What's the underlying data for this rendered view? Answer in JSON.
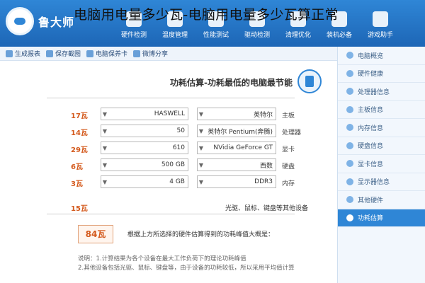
{
  "overlay_title": "电脑用电量多少瓦-电脑用电量多少瓦算正常",
  "app": {
    "brand": "鲁大师"
  },
  "header_tabs": [
    {
      "label": "硬件检测",
      "active": false
    },
    {
      "label": "温度管理",
      "active": false
    },
    {
      "label": "性能测试",
      "active": false
    },
    {
      "label": "驱动检测",
      "active": false
    },
    {
      "label": "清理优化",
      "active": false
    },
    {
      "label": "装机必备",
      "active": false
    },
    {
      "label": "游戏助手",
      "active": false
    }
  ],
  "toolbar": [
    {
      "label": "生成报表"
    },
    {
      "label": "保存截图"
    },
    {
      "label": "电脑保养卡"
    },
    {
      "label": "微博分享"
    }
  ],
  "sidebar": [
    {
      "label": "电脑概览",
      "active": false
    },
    {
      "label": "硬件健康",
      "active": false
    },
    {
      "label": "处理器信息",
      "active": false
    },
    {
      "label": "主板信息",
      "active": false
    },
    {
      "label": "内存信息",
      "active": false
    },
    {
      "label": "硬盘信息",
      "active": false
    },
    {
      "label": "显卡信息",
      "active": false
    },
    {
      "label": "显示器信息",
      "active": false
    },
    {
      "label": "其他硬件",
      "active": false
    },
    {
      "label": "功耗估算",
      "active": true
    }
  ],
  "main": {
    "title": "功耗估算-功耗最低的电脑最节能",
    "rows": [
      {
        "watt": "17瓦",
        "left_value": "HASWELL",
        "right_value": "英特尔",
        "label": "主板"
      },
      {
        "watt": "14瓦",
        "left_value": "50",
        "right_value": "英特尔 Pentium(奔腾)",
        "label": "处理器"
      },
      {
        "watt": "29瓦",
        "left_value": "610",
        "right_value": "NVidia GeForce GT",
        "label": "显卡"
      },
      {
        "watt": "6瓦",
        "left_value": "500 GB",
        "right_value": "西数",
        "label": "硬盘"
      },
      {
        "watt": "3瓦",
        "left_value": "4 GB",
        "right_value": "DDR3",
        "label": "内存"
      }
    ],
    "other": {
      "watt": "15瓦",
      "text": "光驱、鼠标、键盘等其他设备"
    },
    "result": {
      "value": "84瓦",
      "text": "根据上方所选择的硬件估算得到的功耗峰值大概是："
    },
    "notes": [
      "说明：1.计算结果为各个设备在最大工作负荷下的理论功耗峰值",
      "2.其他设备包括光驱、鼠标、键盘等，由于设备的功耗较低，所以采用平均值计算"
    ]
  }
}
